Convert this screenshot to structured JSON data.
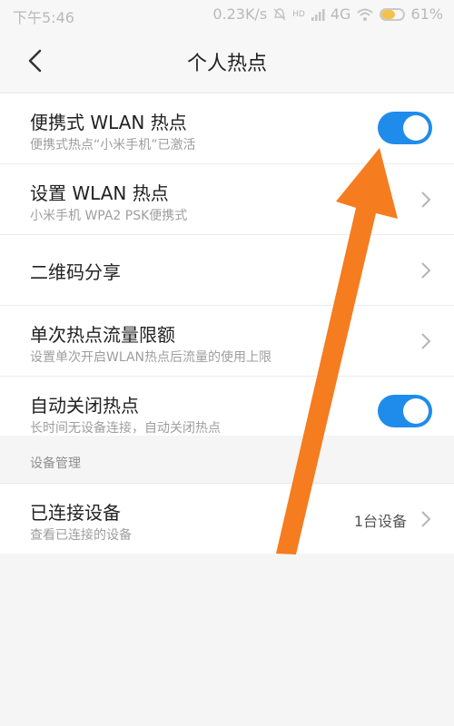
{
  "status_bar": {
    "time": "下午5:46",
    "speed": "0.23K/s",
    "network": "4G",
    "hd_label": "HD",
    "battery": "61%",
    "battery_level": 0.61,
    "icons": [
      "mute-icon",
      "signal-icon",
      "wifi-icon",
      "battery-icon"
    ]
  },
  "header": {
    "title": "个人热点",
    "back_icon": "chevron-left-icon"
  },
  "settings": {
    "items": [
      {
        "title": "便携式 WLAN 热点",
        "subtitle": "便携式热点“小米手机”已激活",
        "control": "toggle",
        "on": true
      },
      {
        "title": "设置 WLAN 热点",
        "subtitle": "小米手机 WPA2 PSK便携式",
        "control": "chevron"
      },
      {
        "title": "二维码分享",
        "control": "chevron"
      },
      {
        "title": "单次热点流量限额",
        "subtitle": "设置单次开启WLAN热点后流量的使用上限",
        "control": "chevron"
      },
      {
        "title": "自动关闭热点",
        "subtitle": "长时间无设备连接，自动关闭热点",
        "control": "toggle",
        "on": true
      }
    ]
  },
  "device_section": {
    "label": "设备管理",
    "item": {
      "title": "已连接设备",
      "subtitle": "查看已连接的设备",
      "value": "1台设备",
      "control": "chevron"
    }
  },
  "colors": {
    "accent": "#1f8ceb",
    "annotation_arrow": "#f57c1f"
  }
}
